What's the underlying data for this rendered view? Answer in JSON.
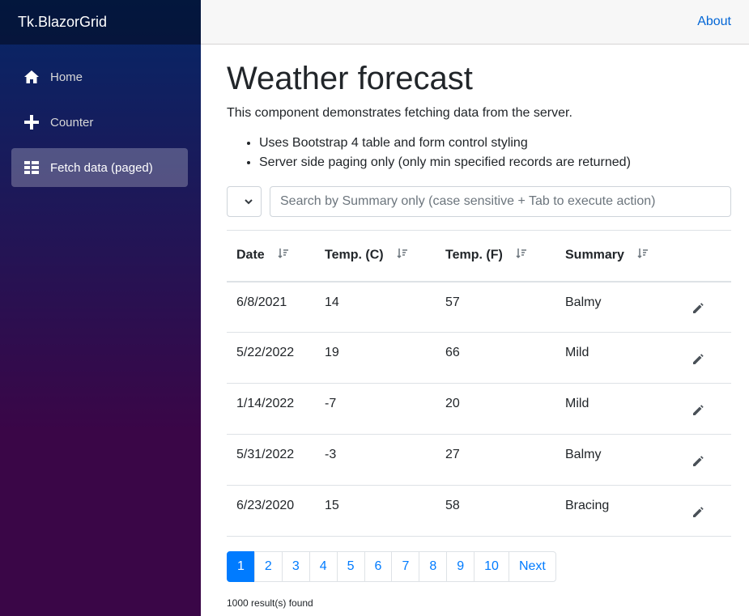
{
  "app": {
    "brand": "Tk.BlazorGrid"
  },
  "nav": [
    {
      "label": "Home",
      "icon": "home-icon"
    },
    {
      "label": "Counter",
      "icon": "plus-icon"
    },
    {
      "label": "Fetch data (paged)",
      "icon": "list-icon",
      "active": true
    }
  ],
  "topbar": {
    "about": "About"
  },
  "page": {
    "title": "Weather forecast",
    "description": "This component demonstrates fetching data from the server.",
    "bullets": [
      "Uses Bootstrap 4 table and form control styling",
      "Server side paging only (only min specified records are returned)"
    ]
  },
  "filters": {
    "page_size_value": "",
    "search_placeholder": "Search by Summary only (case sensitive + Tab to execute action)"
  },
  "table": {
    "columns": [
      "Date",
      "Temp. (C)",
      "Temp. (F)",
      "Summary"
    ],
    "rows": [
      [
        "6/8/2021",
        "14",
        "57",
        "Balmy"
      ],
      [
        "5/22/2022",
        "19",
        "66",
        "Mild"
      ],
      [
        "1/14/2022",
        "-7",
        "20",
        "Mild"
      ],
      [
        "5/31/2022",
        "-3",
        "27",
        "Balmy"
      ],
      [
        "6/23/2020",
        "15",
        "58",
        "Bracing"
      ]
    ]
  },
  "pagination": {
    "pages": [
      "1",
      "2",
      "3",
      "4",
      "5",
      "6",
      "7",
      "8",
      "9",
      "10"
    ],
    "active": "1",
    "next": "Next"
  },
  "result_count": "1000 result(s) found",
  "colors": {
    "accent": "#007bff",
    "sidebar_top": "#052767",
    "sidebar_bottom": "#3a0647"
  }
}
